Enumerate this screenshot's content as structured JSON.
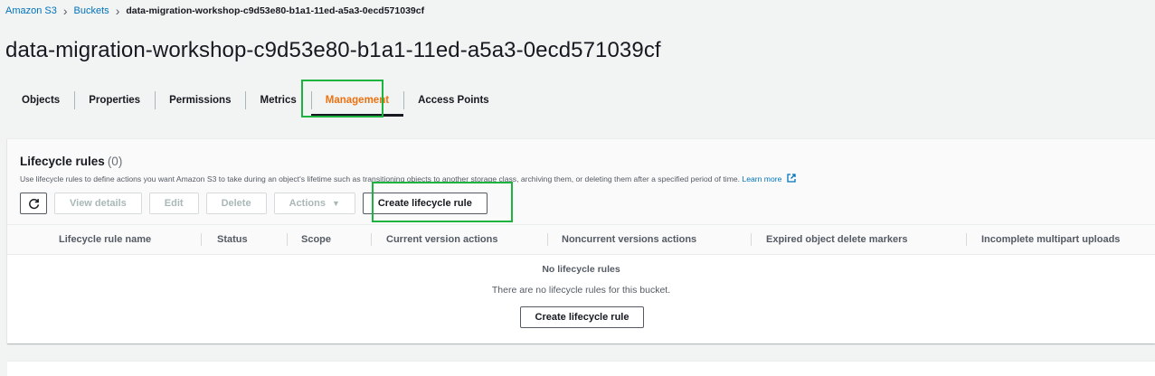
{
  "breadcrumb": {
    "items": [
      "Amazon S3",
      "Buckets"
    ],
    "current": "data-migration-workshop-c9d53e80-b1a1-11ed-a5a3-0ecd571039cf",
    "separator_icon": "chevron-right-icon"
  },
  "page": {
    "title": "data-migration-workshop-c9d53e80-b1a1-11ed-a5a3-0ecd571039cf"
  },
  "tabs": [
    {
      "label": "Objects",
      "active": false
    },
    {
      "label": "Properties",
      "active": false
    },
    {
      "label": "Permissions",
      "active": false
    },
    {
      "label": "Metrics",
      "active": false
    },
    {
      "label": "Management",
      "active": true
    },
    {
      "label": "Access Points",
      "active": false
    }
  ],
  "lifecycle": {
    "title": "Lifecycle rules",
    "count": "(0)",
    "description": "Use lifecycle rules to define actions you want Amazon S3 to take during an object's lifetime such as transitioning objects to another storage class, archiving them, or deleting them after a specified period of time.",
    "learn_more": "Learn more",
    "toolbar": {
      "refresh_icon": "refresh-icon",
      "view_details": "View details",
      "edit": "Edit",
      "delete": "Delete",
      "actions": "Actions",
      "actions_caret": "▼",
      "create": "Create lifecycle rule"
    },
    "columns": [
      "Lifecycle rule name",
      "Status",
      "Scope",
      "Current version actions",
      "Noncurrent versions actions",
      "Expired object delete markers",
      "Incomplete multipart uploads"
    ],
    "empty": {
      "title": "No lifecycle rules",
      "description": "There are no lifecycle rules for this bucket.",
      "button": "Create lifecycle rule"
    }
  },
  "colors": {
    "link": "#0073bb",
    "active_tab": "#ec7211",
    "highlight_box": "#1db33f",
    "text": "#16191f",
    "muted": "#545b64",
    "disabled": "#aab7b8"
  }
}
